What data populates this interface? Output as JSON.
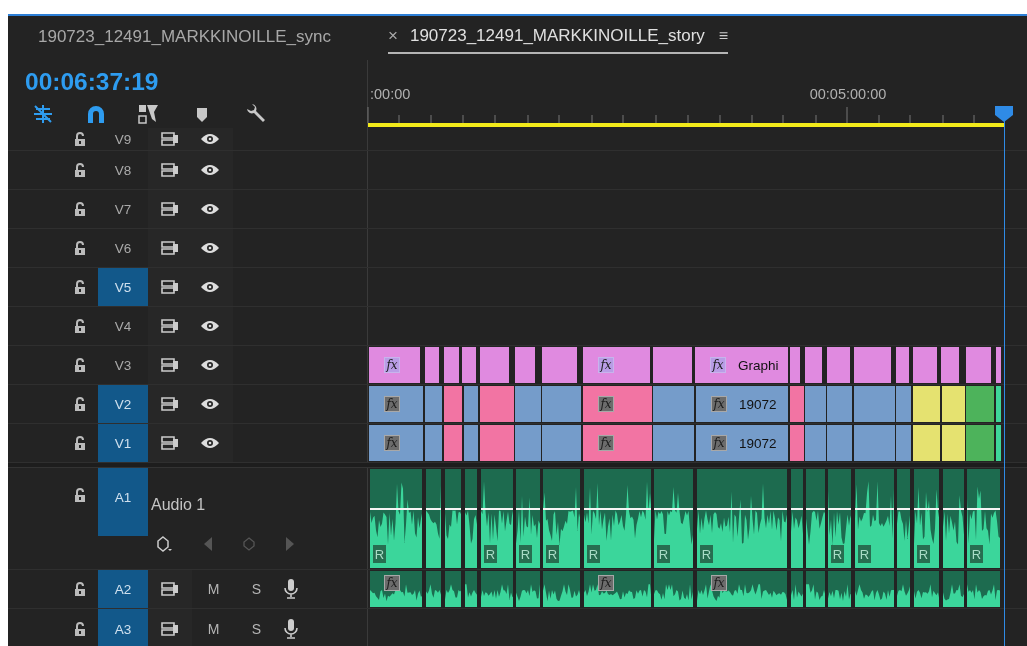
{
  "tabs": [
    {
      "label": "190723_12491_MARKKINOILLE_sync",
      "selected": false
    },
    {
      "close": "×",
      "label": "190723_12491_MARKKINOILLE_story",
      "menu": "≡",
      "selected": true
    }
  ],
  "timecode": "00:06:37:19",
  "tools": [
    {
      "kind": "snap",
      "on": true
    },
    {
      "kind": "linked",
      "on": true
    },
    {
      "kind": "insert",
      "on": false
    },
    {
      "kind": "marker",
      "on": false
    },
    {
      "kind": "wrench",
      "on": false
    }
  ],
  "ruler": {
    "labels": [
      ":00:00",
      "00:05:00:00"
    ]
  },
  "video_tracks": [
    {
      "name": "V9",
      "selected": false
    },
    {
      "name": "V8",
      "selected": false
    },
    {
      "name": "V7",
      "selected": false
    },
    {
      "name": "V6",
      "selected": false
    },
    {
      "name": "V5",
      "selected": true
    },
    {
      "name": "V4",
      "selected": false
    },
    {
      "name": "V3",
      "selected": false,
      "clips": [
        {
          "color": "#e08ae0",
          "fx": "fx"
        },
        {
          "color": "#e08ae0"
        },
        {
          "color": "#e08ae0"
        },
        {
          "color": "#e08ae0"
        },
        {
          "color": "#e08ae0"
        },
        {
          "color": "#e08ae0"
        },
        {
          "color": "#e08ae0"
        },
        {
          "color": "#e08ae0",
          "fx": "fx"
        },
        {
          "color": "#e08ae0"
        },
        {
          "color": "#e08ae0",
          "fx": "fx",
          "label": "Graphi"
        },
        {
          "color": "#e08ae0"
        },
        {
          "color": "#e08ae0"
        },
        {
          "color": "#e08ae0"
        },
        {
          "color": "#e08ae0"
        },
        {
          "color": "#e08ae0"
        },
        {
          "color": "#e08ae0"
        },
        {
          "color": "#e08ae0"
        },
        {
          "color": "#e08ae0"
        },
        {
          "color": "#e08ae0"
        }
      ]
    },
    {
      "name": "V2",
      "selected": true,
      "clips": [
        {
          "color": "#759cca",
          "fx": "fx"
        },
        {
          "color": "#759cca"
        },
        {
          "color": "#f274a3"
        },
        {
          "color": "#759cca"
        },
        {
          "color": "#f274a3"
        },
        {
          "color": "#759cca"
        },
        {
          "color": "#759cca"
        },
        {
          "color": "#f274a3",
          "fx": "fx"
        },
        {
          "color": "#759cca"
        },
        {
          "color": "#759cca",
          "fx": "fx",
          "label": "19072"
        },
        {
          "color": "#f274a3"
        },
        {
          "color": "#759cca"
        },
        {
          "color": "#759cca"
        },
        {
          "color": "#759cca"
        },
        {
          "color": "#759cca"
        },
        {
          "color": "#e5e270"
        },
        {
          "color": "#e5e270"
        },
        {
          "color": "#4db35b"
        },
        {
          "color": "#3fd69a"
        }
      ]
    },
    {
      "name": "V1",
      "selected": true,
      "clips": [
        {
          "color": "#759cca",
          "fx": "fx"
        },
        {
          "color": "#759cca"
        },
        {
          "color": "#f274a3"
        },
        {
          "color": "#759cca"
        },
        {
          "color": "#f274a3"
        },
        {
          "color": "#759cca"
        },
        {
          "color": "#759cca"
        },
        {
          "color": "#f274a3",
          "fx": "fx"
        },
        {
          "color": "#759cca"
        },
        {
          "color": "#759cca",
          "fx": "fx",
          "label": "19072"
        },
        {
          "color": "#f274a3"
        },
        {
          "color": "#759cca"
        },
        {
          "color": "#759cca"
        },
        {
          "color": "#759cca"
        },
        {
          "color": "#759cca"
        },
        {
          "color": "#e5e270"
        },
        {
          "color": "#e5e270"
        },
        {
          "color": "#4db35b"
        },
        {
          "color": "#3fd69a"
        }
      ]
    }
  ],
  "audio_tracks": [
    {
      "name": "A1",
      "title": "Audio 1",
      "expanded": true,
      "selected": true,
      "clips": [
        {
          "kind": "audio",
          "badge": "R"
        },
        {
          "kind": "audio"
        },
        {
          "kind": "audio"
        },
        {
          "kind": "audio"
        },
        {
          "kind": "audio",
          "badge": "R"
        },
        {
          "kind": "audio",
          "badge": "R"
        },
        {
          "kind": "audio",
          "badge": "R"
        },
        {
          "kind": "audio",
          "badge": "R"
        },
        {
          "kind": "audio",
          "badge": "R"
        },
        {
          "kind": "audio",
          "badge": "R"
        },
        {
          "kind": "audio"
        },
        {
          "kind": "audio"
        },
        {
          "kind": "audio",
          "badge": "R"
        },
        {
          "kind": "audio",
          "badge": "R"
        },
        {
          "kind": "audio"
        },
        {
          "kind": "audio",
          "badge": "R"
        },
        {
          "kind": "audio"
        },
        {
          "kind": "audio",
          "badge": "R"
        }
      ]
    },
    {
      "name": "A2",
      "mute": "M",
      "solo": "S",
      "expanded": false,
      "selected": true,
      "clips": [
        {
          "kind": "audio",
          "fx": "fx"
        },
        {
          "kind": "audio"
        },
        {
          "kind": "audio"
        },
        {
          "kind": "audio"
        },
        {
          "kind": "audio"
        },
        {
          "kind": "audio"
        },
        {
          "kind": "audio"
        },
        {
          "kind": "audio",
          "fx": "fx"
        },
        {
          "kind": "audio"
        },
        {
          "kind": "audio",
          "fx": "fx"
        },
        {
          "kind": "audio"
        },
        {
          "kind": "audio"
        },
        {
          "kind": "audio"
        },
        {
          "kind": "audio"
        },
        {
          "kind": "audio"
        },
        {
          "kind": "audio"
        },
        {
          "kind": "audio"
        },
        {
          "kind": "audio"
        }
      ]
    },
    {
      "name": "A3",
      "mute": "M",
      "solo": "S",
      "expanded": false,
      "selected": true
    }
  ]
}
